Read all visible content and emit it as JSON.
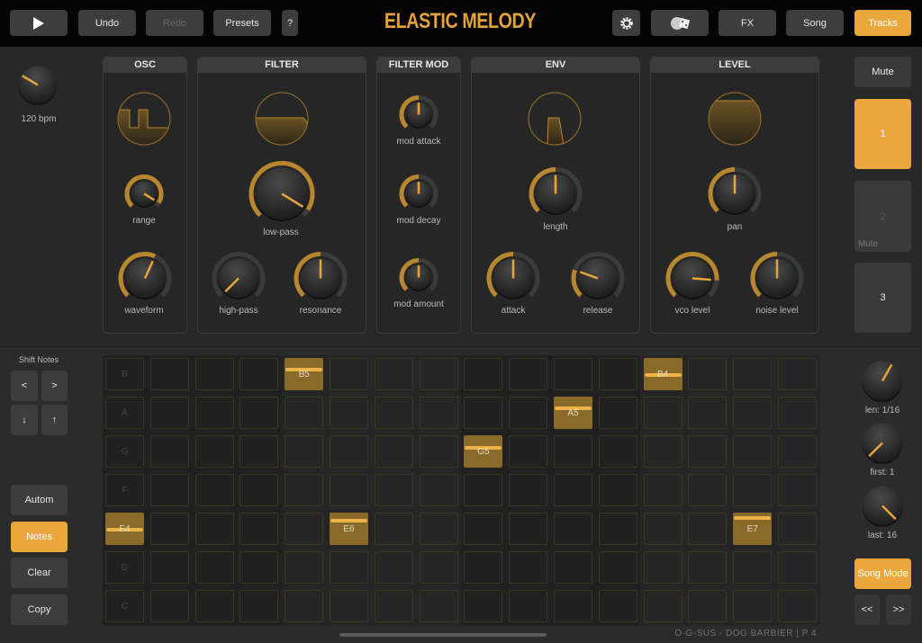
{
  "colors": {
    "accent": "#eaa83c",
    "arc": "#b8862e",
    "track": "#3b3b3b"
  },
  "topbar": {
    "play_icon": "play-icon",
    "undo": "Undo",
    "redo": "Redo",
    "presets": "Presets",
    "help": "?",
    "title": "ELASTIC MELODY",
    "settings_icon": "gear-icon",
    "randomize_icon": "brain-dice-icon",
    "fx": "FX",
    "song": "Song",
    "tracks": "Tracks"
  },
  "tempo": {
    "label": "120 bpm",
    "value": 0.28
  },
  "panels": {
    "osc": "OSC",
    "filter": "FILTER",
    "filter_mod": "FILTER MOD",
    "env": "ENV",
    "level": "LEVEL"
  },
  "knobs": {
    "range": {
      "label": "range",
      "value": 0.95
    },
    "waveform": {
      "label": "waveform",
      "value": 0.59
    },
    "low_pass": {
      "label": "low-pass",
      "value": 0.95
    },
    "high_pass": {
      "label": "high-pass",
      "value": 0.0
    },
    "resonance": {
      "label": "resonance",
      "value": 0.5
    },
    "mod_attack": {
      "label": "mod attack",
      "value": 0.5
    },
    "mod_decay": {
      "label": "mod decay",
      "value": 0.5
    },
    "mod_amount": {
      "label": "mod amount",
      "value": 0.5
    },
    "length": {
      "label": "length",
      "value": 0.5
    },
    "attack": {
      "label": "attack",
      "value": 0.5
    },
    "release": {
      "label": "release",
      "value": 0.24
    },
    "pan": {
      "label": "pan",
      "value": 0.5
    },
    "vco_level": {
      "label": "vco level",
      "value": 0.85
    },
    "noise_level": {
      "label": "noise level",
      "value": 0.5
    },
    "len": {
      "label": "len: 1/16",
      "value": 0.61
    },
    "first": {
      "label": "first: 1",
      "value": 0.0
    },
    "last": {
      "label": "last: 16",
      "value": 1.0
    }
  },
  "tracks": {
    "mute": "Mute",
    "items": [
      {
        "label": "1",
        "active": true
      },
      {
        "label": "2",
        "sub": "Mute"
      },
      {
        "label": "3"
      }
    ]
  },
  "shift": {
    "title": "Shift Notes",
    "left": "<",
    "right": ">",
    "down": "↓",
    "up": "↑"
  },
  "modes": {
    "autom": "Autom",
    "notes": "Notes",
    "clear": "Clear",
    "copy": "Copy"
  },
  "song_mode": "Song Mode",
  "prev": "<<",
  "next": ">>",
  "sequencer": {
    "rows": [
      "B",
      "A",
      "G",
      "F",
      "E",
      "D",
      "C"
    ],
    "steps": 16,
    "notes": [
      {
        "row": 4,
        "step": 0,
        "label": "E4",
        "level": 0.5
      },
      {
        "row": 0,
        "step": 4,
        "label": "B5",
        "level": 0.3
      },
      {
        "row": 4,
        "step": 5,
        "label": "E6",
        "level": 0.2
      },
      {
        "row": 2,
        "step": 8,
        "label": "G5",
        "level": 0.35
      },
      {
        "row": 1,
        "step": 10,
        "label": "A5",
        "level": 0.3
      },
      {
        "row": 0,
        "step": 12,
        "label": "B4",
        "level": 0.5
      },
      {
        "row": 4,
        "step": 14,
        "label": "E7",
        "level": 0.1
      }
    ]
  },
  "footer": "O-G-SUS - DOG BARBIER  |  P 4"
}
